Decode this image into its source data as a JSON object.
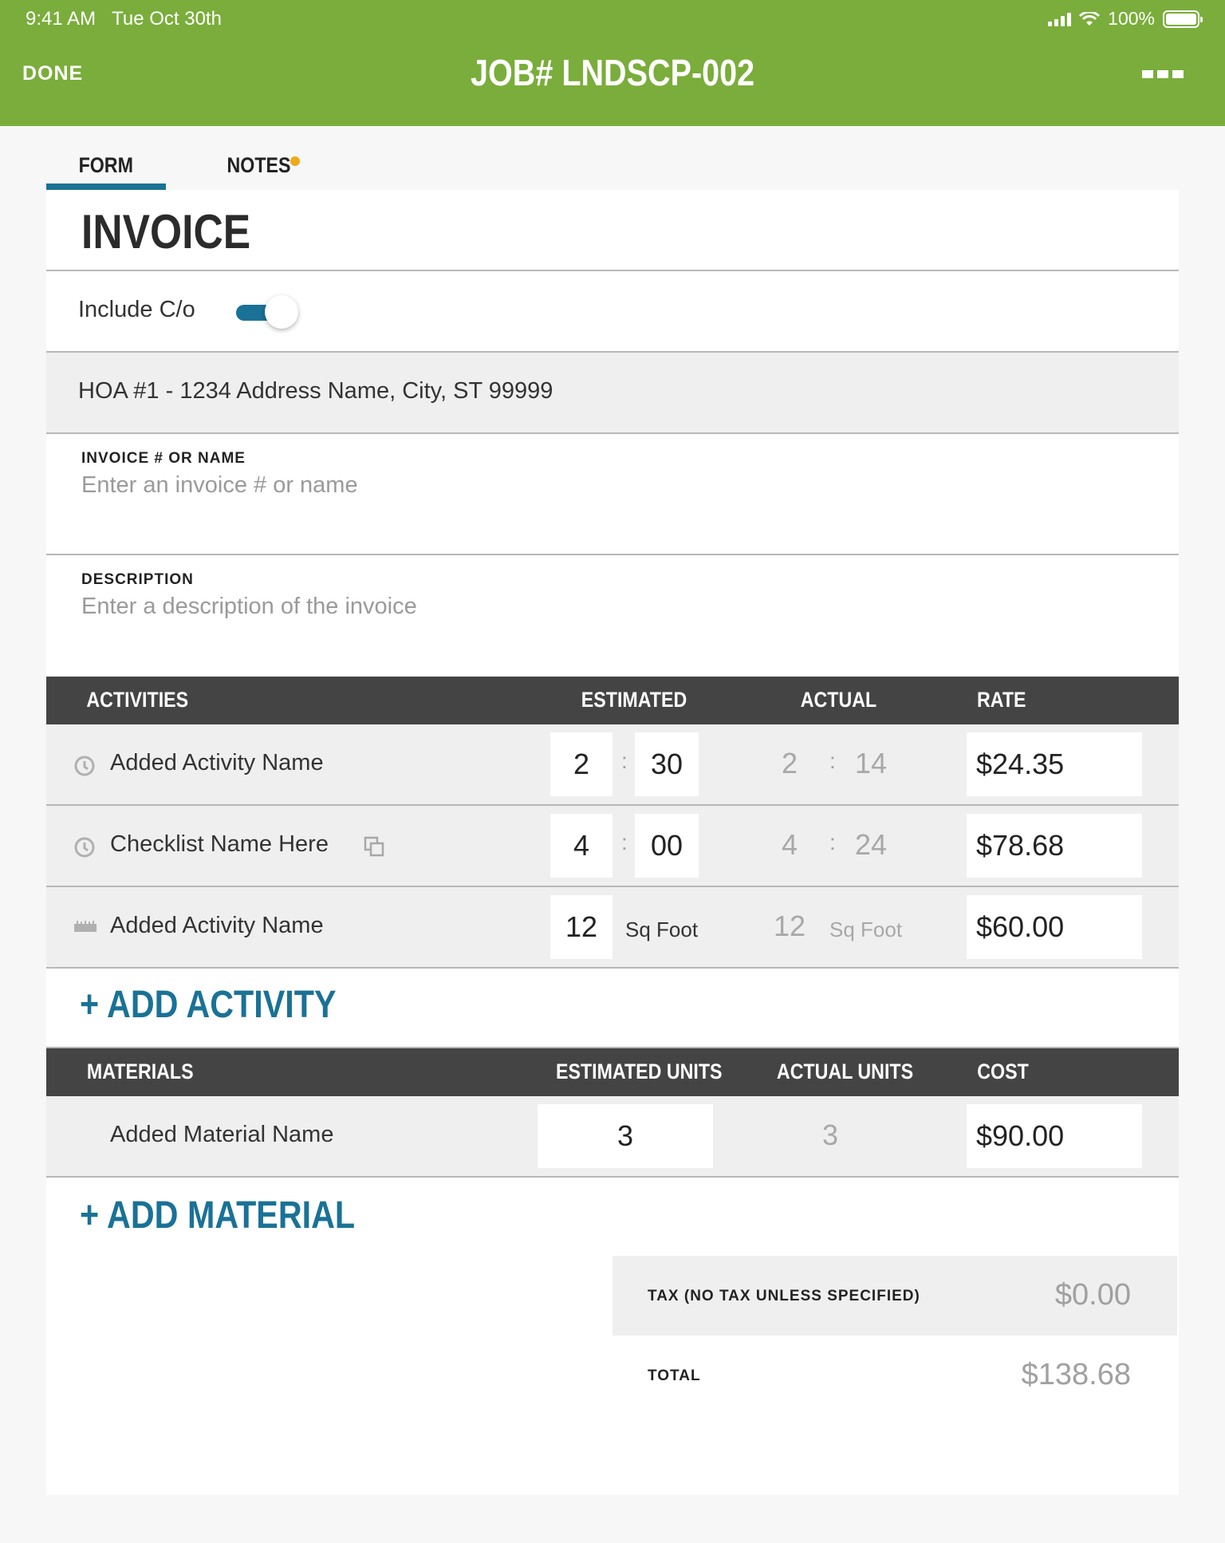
{
  "status_bar": {
    "time": "9:41 AM",
    "date": "Tue Oct 30th",
    "battery": "100%"
  },
  "nav": {
    "done_label": "DONE",
    "title": "JOB# LNDSCP-002",
    "more_icon": "more-dots-icon"
  },
  "tabs": [
    {
      "label": "FORM",
      "active": true
    },
    {
      "label": "NOTES",
      "active": false,
      "has_indicator": true
    }
  ],
  "colors": {
    "brand_green": "#7aad3b",
    "accent_blue": "#1a7296",
    "notes_dot": "#f0a91a",
    "header_dark": "#444444"
  },
  "invoice": {
    "title": "INVOICE",
    "include_co_label": "Include C/o",
    "include_co_on": true,
    "address": "HOA #1 - 1234 Address Name, City, ST 99999",
    "invoice_label": "INVOICE # OR NAME",
    "invoice_placeholder": "Enter an invoice # or name",
    "description_label": "DESCRIPTION",
    "description_placeholder": "Enter a description of the invoice"
  },
  "activities": {
    "headers": {
      "name": "ACTIVITIES",
      "estimated": "ESTIMATED",
      "actual": "ACTUAL",
      "rate": "RATE"
    },
    "rows": [
      {
        "icon": "clock-icon",
        "name": "Added Activity Name",
        "est_a": "2",
        "est_b": "30",
        "act_a": "2",
        "act_b": "14",
        "rate": "$24.35"
      },
      {
        "icon": "clock-icon",
        "name": "Checklist Name Here",
        "extra_icon": "copy-icon",
        "est_a": "4",
        "est_b": "00",
        "act_a": "4",
        "act_b": "24",
        "rate": "$78.68"
      },
      {
        "icon": "ruler-icon",
        "name": "Added Activity Name",
        "est_a": "12",
        "est_unit": "Sq Foot",
        "act_a": "12",
        "act_unit": "Sq Foot",
        "rate": "$60.00"
      }
    ],
    "add_label": "+ ADD ACTIVITY"
  },
  "materials": {
    "headers": {
      "name": "MATERIALS",
      "estimated": "ESTIMATED UNITS",
      "actual": "ACTUAL UNITS",
      "cost": "COST"
    },
    "rows": [
      {
        "name": "Added Material Name",
        "est": "3",
        "act": "3",
        "cost": "$90.00"
      }
    ],
    "add_label": "+ ADD MATERIAL"
  },
  "summary": {
    "tax_label": "TAX (NO TAX UNLESS SPECIFIED)",
    "tax_value": "$0.00",
    "total_label": "TOTAL",
    "total_value": "$138.68"
  }
}
